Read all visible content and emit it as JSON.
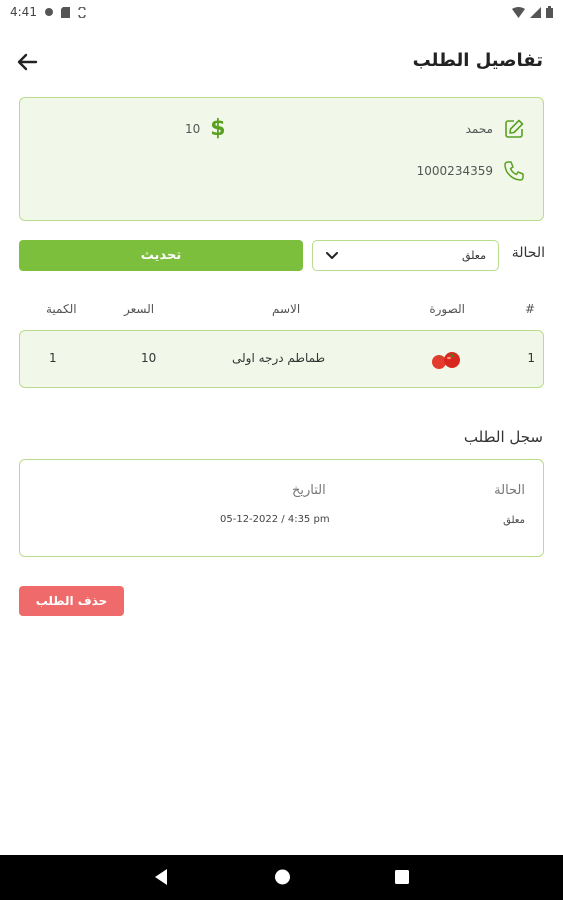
{
  "status_bar": {
    "time": "4:41"
  },
  "header": {
    "title": "تفاصيل الطلب"
  },
  "customer": {
    "name": "محمد",
    "phone": "1000234359",
    "amount": "10"
  },
  "status_control": {
    "label": "الحالة",
    "selected": "معلق",
    "update_label": "تحديث"
  },
  "items_table": {
    "headers": {
      "index": "#",
      "image": "الصورة",
      "name": "الاسم",
      "price": "السعر",
      "quantity": "الكمية"
    },
    "rows": [
      {
        "index": "1",
        "name": "طماطم درجه اولى",
        "price": "10",
        "quantity": "1"
      }
    ]
  },
  "order_log": {
    "title": "سجل الطلب",
    "status_header": "الحالة",
    "date_header": "التاريخ",
    "entries": [
      {
        "status": "معلق",
        "date": "05-12-2022 / 4:35 pm"
      }
    ]
  },
  "actions": {
    "delete_label": "حذف الطلب"
  },
  "colors": {
    "accent_green": "#7cbf3c",
    "card_border": "#b8dc8c",
    "card_bg": "#f2f8e9",
    "danger": "#ef6a6a"
  }
}
